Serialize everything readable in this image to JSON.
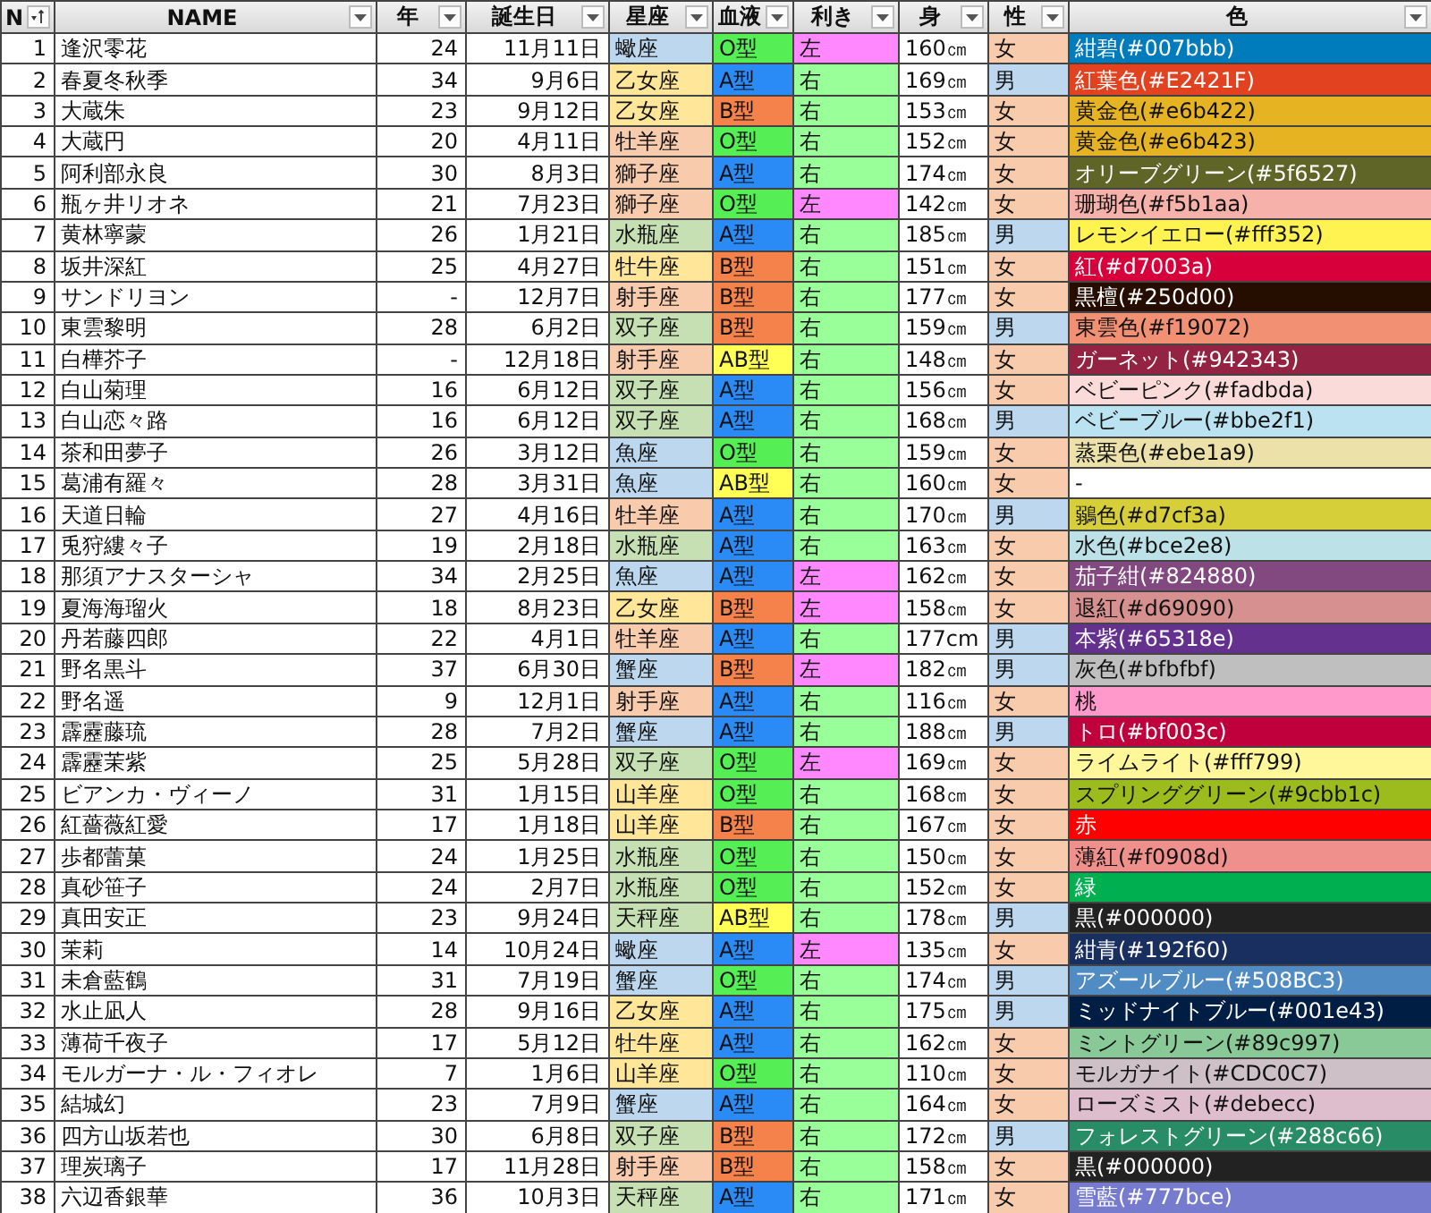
{
  "table": {
    "columns": [
      {
        "label": "N",
        "kind": "sorted"
      },
      {
        "label": "NAME",
        "kind": "filter"
      },
      {
        "label": "年",
        "kind": "filter"
      },
      {
        "label": "誕生日",
        "kind": "filter"
      },
      {
        "label": "星座",
        "kind": "filter"
      },
      {
        "label": "血液",
        "kind": "filter"
      },
      {
        "label": "利き",
        "kind": "filter"
      },
      {
        "label": "身",
        "kind": "filter"
      },
      {
        "label": "性",
        "kind": "filter"
      },
      {
        "label": "色",
        "kind": "filter"
      }
    ],
    "rows": [
      {
        "no": "1",
        "name": "逢沢零花",
        "age": "24",
        "birthday": "11月11日",
        "sign": {
          "text": "蠍座",
          "color": "#bdd7ee"
        },
        "blood": {
          "text": "O型",
          "color": "#55ee55"
        },
        "hand": {
          "text": "左",
          "color": "#ff88ff"
        },
        "height": "160㎝",
        "sex": {
          "text": "女",
          "color": "#f8cbad"
        },
        "swatch": {
          "text": "紺碧(#007bbb)",
          "color": "#007bbb"
        }
      },
      {
        "no": "2",
        "name": "春夏冬秋季",
        "age": "34",
        "birthday": "9月6日",
        "sign": {
          "text": "乙女座",
          "color": "#ffe699"
        },
        "blood": {
          "text": "A型",
          "color": "#2a8af6"
        },
        "hand": {
          "text": "右",
          "color": "#99ff99"
        },
        "height": "169㎝",
        "sex": {
          "text": "男",
          "color": "#bdd7ee"
        },
        "swatch": {
          "text": "紅葉色(#E2421F)",
          "color": "#e2421f"
        }
      },
      {
        "no": "3",
        "name": "大蔵朱",
        "age": "23",
        "birthday": "9月12日",
        "sign": {
          "text": "乙女座",
          "color": "#ffe699"
        },
        "blood": {
          "text": "B型",
          "color": "#f4824a"
        },
        "hand": {
          "text": "右",
          "color": "#99ff99"
        },
        "height": "153㎝",
        "sex": {
          "text": "女",
          "color": "#f8cbad"
        },
        "swatch": {
          "text": "黄金色(#e6b422)",
          "color": "#e6b422"
        }
      },
      {
        "no": "4",
        "name": "大蔵円",
        "age": "20",
        "birthday": "4月11日",
        "sign": {
          "text": "牡羊座",
          "color": "#f8cbad"
        },
        "blood": {
          "text": "O型",
          "color": "#55ee55"
        },
        "hand": {
          "text": "右",
          "color": "#99ff99"
        },
        "height": "152㎝",
        "sex": {
          "text": "女",
          "color": "#f8cbad"
        },
        "swatch": {
          "text": "黄金色(#e6b423)",
          "color": "#e6b423"
        }
      },
      {
        "no": "5",
        "name": "阿利部永良",
        "age": "30",
        "birthday": "8月3日",
        "sign": {
          "text": "獅子座",
          "color": "#f8cbad"
        },
        "blood": {
          "text": "A型",
          "color": "#2a8af6"
        },
        "hand": {
          "text": "右",
          "color": "#99ff99"
        },
        "height": "174㎝",
        "sex": {
          "text": "女",
          "color": "#f8cbad"
        },
        "swatch": {
          "text": "オリーブグリーン(#5f6527)",
          "color": "#5f6527"
        }
      },
      {
        "no": "6",
        "name": "瓶ヶ井リオネ",
        "age": "21",
        "birthday": "7月23日",
        "sign": {
          "text": "獅子座",
          "color": "#f8cbad"
        },
        "blood": {
          "text": "O型",
          "color": "#55ee55"
        },
        "hand": {
          "text": "左",
          "color": "#ff88ff"
        },
        "height": "142㎝",
        "sex": {
          "text": "女",
          "color": "#f8cbad"
        },
        "swatch": {
          "text": "珊瑚色(#f5b1aa)",
          "color": "#f5b1aa"
        }
      },
      {
        "no": "7",
        "name": "黄林寧蒙",
        "age": "26",
        "birthday": "1月21日",
        "sign": {
          "text": "水瓶座",
          "color": "#c6e0b4"
        },
        "blood": {
          "text": "A型",
          "color": "#2a8af6"
        },
        "hand": {
          "text": "右",
          "color": "#99ff99"
        },
        "height": "185㎝",
        "sex": {
          "text": "男",
          "color": "#bdd7ee"
        },
        "swatch": {
          "text": "レモンイエロー(#fff352)",
          "color": "#fff352"
        }
      },
      {
        "no": "8",
        "name": "坂井深紅",
        "age": "25",
        "birthday": "4月27日",
        "sign": {
          "text": "牡牛座",
          "color": "#ffe699"
        },
        "blood": {
          "text": "B型",
          "color": "#f4824a"
        },
        "hand": {
          "text": "右",
          "color": "#99ff99"
        },
        "height": "151㎝",
        "sex": {
          "text": "女",
          "color": "#f8cbad"
        },
        "swatch": {
          "text": "紅(#d7003a)",
          "color": "#d7003a"
        }
      },
      {
        "no": "9",
        "name": "サンドリヨン",
        "age": "-",
        "birthday": "12月7日",
        "sign": {
          "text": "射手座",
          "color": "#f8cbad"
        },
        "blood": {
          "text": "B型",
          "color": "#f4824a"
        },
        "hand": {
          "text": "右",
          "color": "#99ff99"
        },
        "height": "177㎝",
        "sex": {
          "text": "女",
          "color": "#f8cbad"
        },
        "swatch": {
          "text": "黒檀(#250d00)",
          "color": "#250d00"
        }
      },
      {
        "no": "10",
        "name": "東雲黎明",
        "age": "28",
        "birthday": "6月2日",
        "sign": {
          "text": "双子座",
          "color": "#c6e0b4"
        },
        "blood": {
          "text": "B型",
          "color": "#f4824a"
        },
        "hand": {
          "text": "右",
          "color": "#99ff99"
        },
        "height": "159㎝",
        "sex": {
          "text": "男",
          "color": "#bdd7ee"
        },
        "swatch": {
          "text": "東雲色(#f19072)",
          "color": "#f19072"
        }
      },
      {
        "no": "11",
        "name": "白樺芥子",
        "age": "-",
        "birthday": "12月18日",
        "sign": {
          "text": "射手座",
          "color": "#f8cbad"
        },
        "blood": {
          "text": "AB型",
          "color": "#ffff55"
        },
        "hand": {
          "text": "右",
          "color": "#99ff99"
        },
        "height": "148㎝",
        "sex": {
          "text": "女",
          "color": "#f8cbad"
        },
        "swatch": {
          "text": "ガーネット(#942343)",
          "color": "#942343"
        }
      },
      {
        "no": "12",
        "name": "白山菊理",
        "age": "16",
        "birthday": "6月12日",
        "sign": {
          "text": "双子座",
          "color": "#c6e0b4"
        },
        "blood": {
          "text": "A型",
          "color": "#2a8af6"
        },
        "hand": {
          "text": "右",
          "color": "#99ff99"
        },
        "height": "156㎝",
        "sex": {
          "text": "女",
          "color": "#f8cbad"
        },
        "swatch": {
          "text": "ベビーピンク(#fadbda)",
          "color": "#fadbda"
        }
      },
      {
        "no": "13",
        "name": "白山恋々路",
        "age": "16",
        "birthday": "6月12日",
        "sign": {
          "text": "双子座",
          "color": "#c6e0b4"
        },
        "blood": {
          "text": "A型",
          "color": "#2a8af6"
        },
        "hand": {
          "text": "右",
          "color": "#99ff99"
        },
        "height": "168㎝",
        "sex": {
          "text": "男",
          "color": "#bdd7ee"
        },
        "swatch": {
          "text": "ベビーブルー(#bbe2f1)",
          "color": "#bbe2f1"
        }
      },
      {
        "no": "14",
        "name": "茶和田夢子",
        "age": "26",
        "birthday": "3月12日",
        "sign": {
          "text": "魚座",
          "color": "#bdd7ee"
        },
        "blood": {
          "text": "O型",
          "color": "#55ee55"
        },
        "hand": {
          "text": "右",
          "color": "#99ff99"
        },
        "height": "159㎝",
        "sex": {
          "text": "女",
          "color": "#f8cbad"
        },
        "swatch": {
          "text": "蒸栗色(#ebe1a9)",
          "color": "#ebe1a9"
        }
      },
      {
        "no": "15",
        "name": "葛浦有羅々",
        "age": "28",
        "birthday": "3月31日",
        "sign": {
          "text": "魚座",
          "color": "#bdd7ee"
        },
        "blood": {
          "text": "AB型",
          "color": "#ffff55"
        },
        "hand": {
          "text": "右",
          "color": "#99ff99"
        },
        "height": "160㎝",
        "sex": {
          "text": "女",
          "color": "#f8cbad"
        },
        "swatch": {
          "text": "-",
          "color": "#ffffff"
        }
      },
      {
        "no": "16",
        "name": "天道日輪",
        "age": "27",
        "birthday": "4月16日",
        "sign": {
          "text": "牡羊座",
          "color": "#f8cbad"
        },
        "blood": {
          "text": "A型",
          "color": "#2a8af6"
        },
        "hand": {
          "text": "右",
          "color": "#99ff99"
        },
        "height": "170㎝",
        "sex": {
          "text": "男",
          "color": "#bdd7ee"
        },
        "swatch": {
          "text": "鶸色(#d7cf3a)",
          "color": "#d7cf3a"
        }
      },
      {
        "no": "17",
        "name": "兎狩縷々子",
        "age": "19",
        "birthday": "2月18日",
        "sign": {
          "text": "水瓶座",
          "color": "#c6e0b4"
        },
        "blood": {
          "text": "A型",
          "color": "#2a8af6"
        },
        "hand": {
          "text": "右",
          "color": "#99ff99"
        },
        "height": "163㎝",
        "sex": {
          "text": "女",
          "color": "#f8cbad"
        },
        "swatch": {
          "text": "水色(#bce2e8)",
          "color": "#bce2e8"
        }
      },
      {
        "no": "18",
        "name": "那須アナスターシャ",
        "age": "34",
        "birthday": "2月25日",
        "sign": {
          "text": "魚座",
          "color": "#bdd7ee"
        },
        "blood": {
          "text": "A型",
          "color": "#2a8af6"
        },
        "hand": {
          "text": "左",
          "color": "#ff88ff"
        },
        "height": "162㎝",
        "sex": {
          "text": "女",
          "color": "#f8cbad"
        },
        "swatch": {
          "text": "茄子紺(#824880)",
          "color": "#824880"
        }
      },
      {
        "no": "19",
        "name": "夏海海瑠火",
        "age": "18",
        "birthday": "8月23日",
        "sign": {
          "text": "乙女座",
          "color": "#ffe699"
        },
        "blood": {
          "text": "B型",
          "color": "#f4824a"
        },
        "hand": {
          "text": "左",
          "color": "#ff88ff"
        },
        "height": "158㎝",
        "sex": {
          "text": "女",
          "color": "#f8cbad"
        },
        "swatch": {
          "text": "退紅(#d69090)",
          "color": "#d69090"
        }
      },
      {
        "no": "20",
        "name": "丹若藤四郎",
        "age": "22",
        "birthday": "4月1日",
        "sign": {
          "text": "牡羊座",
          "color": "#f8cbad"
        },
        "blood": {
          "text": "A型",
          "color": "#2a8af6"
        },
        "hand": {
          "text": "右",
          "color": "#99ff99"
        },
        "height": "177cm",
        "sex": {
          "text": "男",
          "color": "#bdd7ee"
        },
        "swatch": {
          "text": "本紫(#65318e)",
          "color": "#65318e"
        }
      },
      {
        "no": "21",
        "name": "野名黒斗",
        "age": "37",
        "birthday": "6月30日",
        "sign": {
          "text": "蟹座",
          "color": "#bdd7ee"
        },
        "blood": {
          "text": "B型",
          "color": "#f4824a"
        },
        "hand": {
          "text": "左",
          "color": "#ff88ff"
        },
        "height": "182㎝",
        "sex": {
          "text": "男",
          "color": "#bdd7ee"
        },
        "swatch": {
          "text": "灰色(#bfbfbf)",
          "color": "#bfbfbf"
        }
      },
      {
        "no": "22",
        "name": "野名遥",
        "age": "9",
        "birthday": "12月1日",
        "sign": {
          "text": "射手座",
          "color": "#f8cbad"
        },
        "blood": {
          "text": "A型",
          "color": "#2a8af6"
        },
        "hand": {
          "text": "右",
          "color": "#99ff99"
        },
        "height": "116㎝",
        "sex": {
          "text": "女",
          "color": "#f8cbad"
        },
        "swatch": {
          "text": "桃",
          "color": "#ff99cc"
        }
      },
      {
        "no": "23",
        "name": "霹靂藤琉",
        "age": "28",
        "birthday": "7月2日",
        "sign": {
          "text": "蟹座",
          "color": "#bdd7ee"
        },
        "blood": {
          "text": "A型",
          "color": "#2a8af6"
        },
        "hand": {
          "text": "右",
          "color": "#99ff99"
        },
        "height": "188㎝",
        "sex": {
          "text": "男",
          "color": "#bdd7ee"
        },
        "swatch": {
          "text": "トロ(#bf003c)",
          "color": "#bf003c"
        }
      },
      {
        "no": "24",
        "name": "霹靂茉紫",
        "age": "25",
        "birthday": "5月28日",
        "sign": {
          "text": "双子座",
          "color": "#c6e0b4"
        },
        "blood": {
          "text": "O型",
          "color": "#55ee55"
        },
        "hand": {
          "text": "左",
          "color": "#ff88ff"
        },
        "height": "169㎝",
        "sex": {
          "text": "女",
          "color": "#f8cbad"
        },
        "swatch": {
          "text": "ライムライト(#fff799)",
          "color": "#fff799"
        }
      },
      {
        "no": "25",
        "name": "ビアンカ・ヴィーノ",
        "age": "31",
        "birthday": "1月15日",
        "sign": {
          "text": "山羊座",
          "color": "#ffe699"
        },
        "blood": {
          "text": "O型",
          "color": "#55ee55"
        },
        "hand": {
          "text": "右",
          "color": "#99ff99"
        },
        "height": "168㎝",
        "sex": {
          "text": "女",
          "color": "#f8cbad"
        },
        "swatch": {
          "text": "スプリンググリーン(#9cbb1c)",
          "color": "#9cbb1c"
        }
      },
      {
        "no": "26",
        "name": "紅薔薇紅愛",
        "age": "17",
        "birthday": "1月18日",
        "sign": {
          "text": "山羊座",
          "color": "#ffe699"
        },
        "blood": {
          "text": "B型",
          "color": "#f4824a"
        },
        "hand": {
          "text": "右",
          "color": "#99ff99"
        },
        "height": "167㎝",
        "sex": {
          "text": "女",
          "color": "#f8cbad"
        },
        "swatch": {
          "text": "赤",
          "color": "#ff0000"
        }
      },
      {
        "no": "27",
        "name": "歩都蕾菓",
        "age": "24",
        "birthday": "1月25日",
        "sign": {
          "text": "水瓶座",
          "color": "#c6e0b4"
        },
        "blood": {
          "text": "O型",
          "color": "#55ee55"
        },
        "hand": {
          "text": "右",
          "color": "#99ff99"
        },
        "height": "150㎝",
        "sex": {
          "text": "女",
          "color": "#f8cbad"
        },
        "swatch": {
          "text": "薄紅(#f0908d)",
          "color": "#f0908d"
        }
      },
      {
        "no": "28",
        "name": "真砂笹子",
        "age": "24",
        "birthday": "2月7日",
        "sign": {
          "text": "水瓶座",
          "color": "#c6e0b4"
        },
        "blood": {
          "text": "O型",
          "color": "#55ee55"
        },
        "hand": {
          "text": "右",
          "color": "#99ff99"
        },
        "height": "152㎝",
        "sex": {
          "text": "女",
          "color": "#f8cbad"
        },
        "swatch": {
          "text": "緑",
          "color": "#00b050"
        }
      },
      {
        "no": "29",
        "name": "真田安正",
        "age": "23",
        "birthday": "9月24日",
        "sign": {
          "text": "天秤座",
          "color": "#c6e0b4"
        },
        "blood": {
          "text": "AB型",
          "color": "#ffff55"
        },
        "hand": {
          "text": "右",
          "color": "#99ff99"
        },
        "height": "178㎝",
        "sex": {
          "text": "男",
          "color": "#bdd7ee"
        },
        "swatch": {
          "text": "黒(#000000)",
          "color": "#222222"
        }
      },
      {
        "no": "30",
        "name": "茉莉",
        "age": "14",
        "birthday": "10月24日",
        "sign": {
          "text": "蠍座",
          "color": "#bdd7ee"
        },
        "blood": {
          "text": "A型",
          "color": "#2a8af6"
        },
        "hand": {
          "text": "左",
          "color": "#ff88ff"
        },
        "height": "135㎝",
        "sex": {
          "text": "女",
          "color": "#f8cbad"
        },
        "swatch": {
          "text": "紺青(#192f60)",
          "color": "#192f60"
        }
      },
      {
        "no": "31",
        "name": "未倉藍鶴",
        "age": "31",
        "birthday": "7月19日",
        "sign": {
          "text": "蟹座",
          "color": "#bdd7ee"
        },
        "blood": {
          "text": "O型",
          "color": "#55ee55"
        },
        "hand": {
          "text": "右",
          "color": "#99ff99"
        },
        "height": "174㎝",
        "sex": {
          "text": "男",
          "color": "#bdd7ee"
        },
        "swatch": {
          "text": "アズールブルー(#508BC3)",
          "color": "#508bc3"
        }
      },
      {
        "no": "32",
        "name": "水止凪人",
        "age": "28",
        "birthday": "9月16日",
        "sign": {
          "text": "乙女座",
          "color": "#ffe699"
        },
        "blood": {
          "text": "A型",
          "color": "#2a8af6"
        },
        "hand": {
          "text": "右",
          "color": "#99ff99"
        },
        "height": "175㎝",
        "sex": {
          "text": "男",
          "color": "#bdd7ee"
        },
        "swatch": {
          "text": "ミッドナイトブルー(#001e43)",
          "color": "#001e43"
        }
      },
      {
        "no": "33",
        "name": "薄荷千夜子",
        "age": "17",
        "birthday": "5月12日",
        "sign": {
          "text": "牡牛座",
          "color": "#ffe699"
        },
        "blood": {
          "text": "A型",
          "color": "#2a8af6"
        },
        "hand": {
          "text": "右",
          "color": "#99ff99"
        },
        "height": "162㎝",
        "sex": {
          "text": "女",
          "color": "#f8cbad"
        },
        "swatch": {
          "text": "ミントグリーン(#89c997)",
          "color": "#89c997"
        }
      },
      {
        "no": "34",
        "name": "モルガーナ・ル・フィオレ",
        "age": "7",
        "birthday": "1月6日",
        "sign": {
          "text": "山羊座",
          "color": "#ffe699"
        },
        "blood": {
          "text": "O型",
          "color": "#55ee55"
        },
        "hand": {
          "text": "右",
          "color": "#99ff99"
        },
        "height": "110㎝",
        "sex": {
          "text": "女",
          "color": "#f8cbad"
        },
        "swatch": {
          "text": "モルガナイト(#CDC0C7)",
          "color": "#cdc0c7"
        }
      },
      {
        "no": "35",
        "name": "結城幻",
        "age": "23",
        "birthday": "7月9日",
        "sign": {
          "text": "蟹座",
          "color": "#bdd7ee"
        },
        "blood": {
          "text": "A型",
          "color": "#2a8af6"
        },
        "hand": {
          "text": "右",
          "color": "#99ff99"
        },
        "height": "164㎝",
        "sex": {
          "text": "女",
          "color": "#f8cbad"
        },
        "swatch": {
          "text": "ローズミスト(#debecc)",
          "color": "#debecc"
        }
      },
      {
        "no": "36",
        "name": "四方山坂若也",
        "age": "30",
        "birthday": "6月8日",
        "sign": {
          "text": "双子座",
          "color": "#c6e0b4"
        },
        "blood": {
          "text": "B型",
          "color": "#f4824a"
        },
        "hand": {
          "text": "右",
          "color": "#99ff99"
        },
        "height": "172㎝",
        "sex": {
          "text": "男",
          "color": "#bdd7ee"
        },
        "swatch": {
          "text": "フォレストグリーン(#288c66)",
          "color": "#288c66"
        }
      },
      {
        "no": "37",
        "name": "理炭璃子",
        "age": "17",
        "birthday": "11月28日",
        "sign": {
          "text": "射手座",
          "color": "#f8cbad"
        },
        "blood": {
          "text": "B型",
          "color": "#f4824a"
        },
        "hand": {
          "text": "右",
          "color": "#99ff99"
        },
        "height": "158㎝",
        "sex": {
          "text": "女",
          "color": "#f8cbad"
        },
        "swatch": {
          "text": "黒(#000000)",
          "color": "#222222"
        }
      },
      {
        "no": "38",
        "name": "六辺香銀華",
        "age": "36",
        "birthday": "10月3日",
        "sign": {
          "text": "天秤座",
          "color": "#c6e0b4"
        },
        "blood": {
          "text": "A型",
          "color": "#2a8af6"
        },
        "hand": {
          "text": "右",
          "color": "#99ff99"
        },
        "height": "171㎝",
        "sex": {
          "text": "女",
          "color": "#f8cbad"
        },
        "swatch": {
          "text": "雪藍(#777bce)",
          "color": "#777bce"
        }
      }
    ]
  }
}
